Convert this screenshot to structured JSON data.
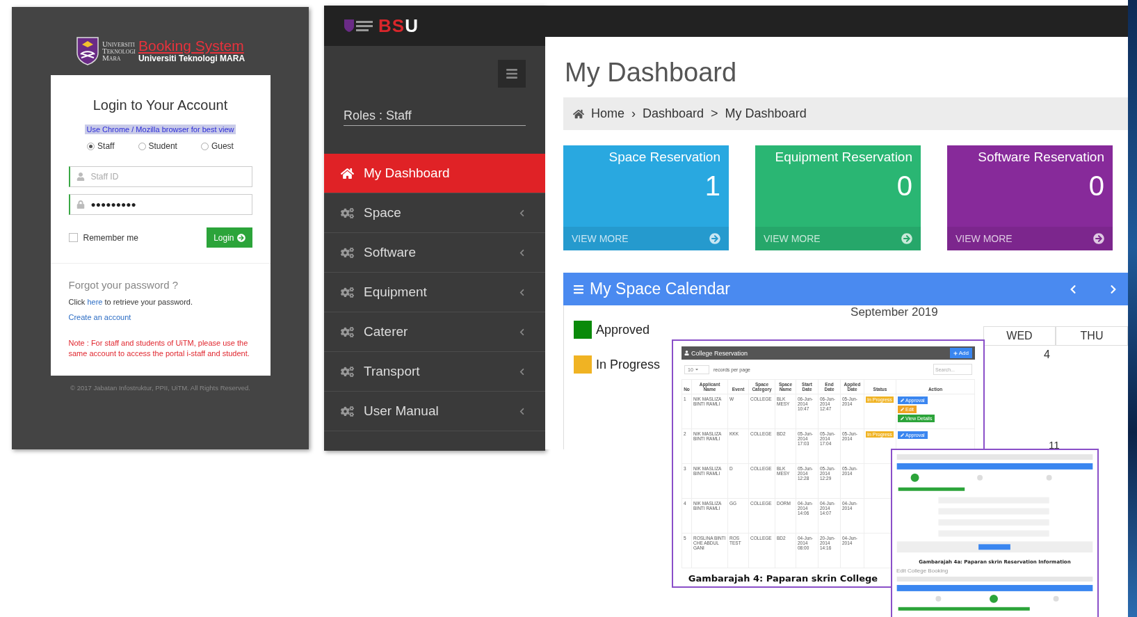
{
  "login": {
    "logo_words": [
      "Universiti",
      "Teknologi",
      "Mara"
    ],
    "logo_title": "Booking System",
    "logo_subtitle": "Universiti Teknologi MARA",
    "heading": "Login to Your Account",
    "browser_note": "Use Chrome / Mozilla browser for best view",
    "roles": [
      {
        "label": "Staff",
        "selected": true
      },
      {
        "label": "Student",
        "selected": false
      },
      {
        "label": "Guest",
        "selected": false
      }
    ],
    "staff_id": {
      "placeholder": "Staff ID"
    },
    "password": {
      "value": "●●●●●●●●●"
    },
    "remember": {
      "label": "Remember me",
      "checked": false
    },
    "login_button": "Login",
    "forgot_heading": "Forgot your password ?",
    "forgot_before": "Click ",
    "forgot_link": "here",
    "forgot_after": " to retrieve your password.",
    "create_account": "Create an account",
    "note": "Note : For staff and students of UiTM, please use the same account to access the portal i-staff and student.",
    "footer": "© 2017 Jabatan Infostruktur, PPII, UiTM. All Rights Reserved."
  },
  "sidebar": {
    "brand": [
      {
        "text": "BS",
        "color": "#d9262b"
      },
      {
        "text": "U",
        "color": "#ffffff"
      }
    ],
    "roles": "Roles : Staff",
    "items": [
      {
        "label": "My Dashboard",
        "kind": "home",
        "selected": true
      },
      {
        "label": "Space",
        "kind": "menu",
        "selected": false
      },
      {
        "label": "Software",
        "kind": "menu",
        "selected": false
      },
      {
        "label": "Equipment",
        "kind": "menu",
        "selected": false
      },
      {
        "label": "Caterer",
        "kind": "menu",
        "selected": false
      },
      {
        "label": "Transport",
        "kind": "menu",
        "selected": false
      },
      {
        "label": "User Manual",
        "kind": "menu",
        "selected": false
      }
    ]
  },
  "dashboard": {
    "title": "My Dashboard",
    "breadcrumb": [
      "Home",
      "Dashboard",
      "My Dashboard"
    ],
    "separators": [
      "›",
      ">"
    ],
    "cards": [
      {
        "title": "Space Reservation",
        "count": "1",
        "link": "VIEW MORE",
        "color": "#29a8e0"
      },
      {
        "title": "Equipment Reservation",
        "count": "0",
        "link": "VIEW MORE",
        "color": "#2ab673"
      },
      {
        "title": "Software Reservation",
        "count": "0",
        "link": "VIEW MORE",
        "color": "#872a9a"
      }
    ],
    "calendar": {
      "title": "My Space Calendar",
      "legend": [
        {
          "label": "Approved",
          "color": "#0a8a0a"
        },
        {
          "label": "In Progress",
          "color": "#f0b323"
        }
      ],
      "month": "September 2019",
      "days": [
        "WED",
        "THU"
      ],
      "dates": [
        "4",
        "11"
      ]
    }
  },
  "reservation_table": {
    "title": "College Reservation",
    "add_button": "Add",
    "page_size": "10",
    "records_label": "records per page",
    "search": {
      "placeholder": "Search..."
    },
    "columns": [
      "No",
      "Applicant Name",
      "Event",
      "Space Category",
      "Space Name",
      "Start Date",
      "End Date",
      "Applied Date",
      "Status",
      "Action"
    ],
    "rows": [
      {
        "cells": [
          "1",
          "NIK MASLIZA BINTI RAMLI",
          "W",
          "COLLEGE",
          "BLK MESY",
          "06-Jun-2014 10:47",
          "06-Jun-2014 12:47",
          "05-Jun-2014"
        ],
        "status": "In Progress",
        "actions": [
          {
            "label": "Approval",
            "kind": "approval"
          },
          {
            "label": "Edit",
            "kind": "edit"
          },
          {
            "label": "View Details",
            "kind": "view"
          }
        ]
      },
      {
        "cells": [
          "2",
          "NIK MASLIZA BINTI RAMLI",
          "KKK",
          "COLLEGE",
          "BD2",
          "05-Jun-2014 17:03",
          "05-Jun-2014 17:04",
          "05-Jun-2014"
        ],
        "status": "In Progress",
        "actions": [
          {
            "label": "Approval",
            "kind": "approval"
          }
        ]
      },
      {
        "cells": [
          "3",
          "NIK MASLIZA BINTI RAMLI",
          "D",
          "COLLEGE",
          "BLK MESY",
          "05-Jun-2014 12:28",
          "05-Jun-2014 12:29",
          "05-Jun-2014"
        ]
      },
      {
        "cells": [
          "4",
          "NIK MASLIZA BINTI RAMLI",
          "GG",
          "COLLEGE",
          "DORM",
          "04-Jun-2014 14:06",
          "04-Jun-2014 14:07",
          "04-Jun-2014"
        ]
      },
      {
        "cells": [
          "5",
          "ROSLINA BINTI CHE ABDUL GANI",
          "ROS TEST",
          "COLLEGE",
          "BD2",
          "04-Jun-2014 08:00",
          "20-Jun-2014 14:16",
          "04-Jun-2014"
        ]
      }
    ],
    "caption": "Gambarajah 4: Paparan skrin College"
  },
  "form_preview": {
    "caption": "Gambarajah 4a: Paparan skrin Reservation Information",
    "heading": "Edit College Booking"
  }
}
